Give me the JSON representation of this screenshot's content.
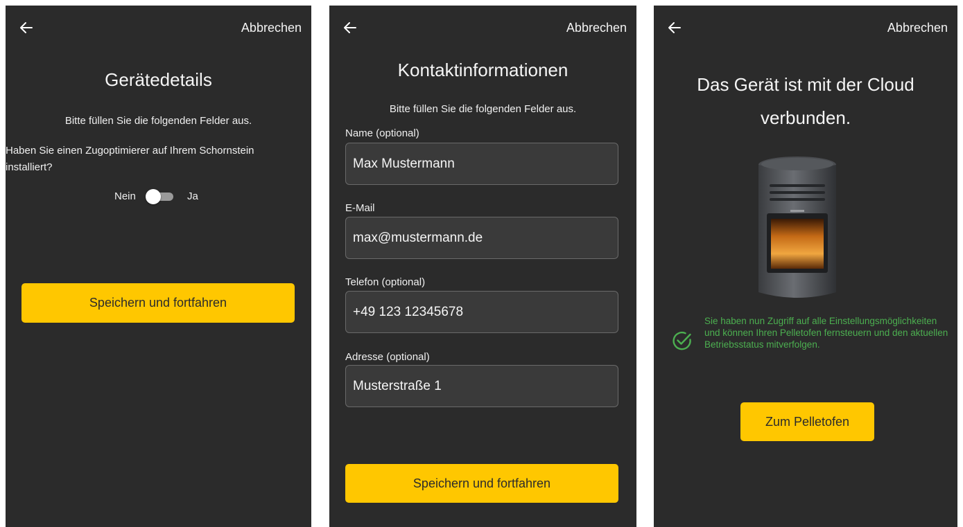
{
  "common": {
    "back_icon": "arrow-left-icon",
    "cancel_label": "Abbrechen"
  },
  "screen1": {
    "title": "Gerätedetails",
    "subtitle": "Bitte füllen Sie die folgenden Felder aus.",
    "question": "Haben Sie einen Zugoptimierer auf Ihrem Schornstein installiert?",
    "toggle_off_label": "Nein",
    "toggle_on_label": "Ja",
    "toggle_state": "off",
    "button": "Speichern und fortfahren"
  },
  "screen2": {
    "title": "Kontaktinformationen",
    "subtitle": "Bitte füllen Sie die folgenden Felder aus.",
    "fields": [
      {
        "label": "Name (optional)",
        "value": "Max Mustermann"
      },
      {
        "label": "E-Mail",
        "value": "max@mustermann.de"
      },
      {
        "label": "Telefon  (optional)",
        "value": "+49 123 12345678"
      },
      {
        "label": "Adresse  (optional)",
        "value": "Musterstraße 1"
      }
    ],
    "button": "Speichern und fortfahren"
  },
  "screen3": {
    "title": "Das Gerät ist mit der Cloud verbunden.",
    "message": "Sie haben nun Zugriff auf alle Einstellungsmöglichkeiten und können Ihren Pelletofen fernsteuern und den aktuellen Betriebsstatus mitverfolgen.",
    "check_icon": "check-circle-icon",
    "image": "pellet-stove-image",
    "button": "Zum Pelletofen"
  },
  "colors": {
    "background": "#2b2b2b",
    "accent": "#ffc700",
    "success": "#4caf50",
    "field_bg": "#3a3a3a"
  }
}
